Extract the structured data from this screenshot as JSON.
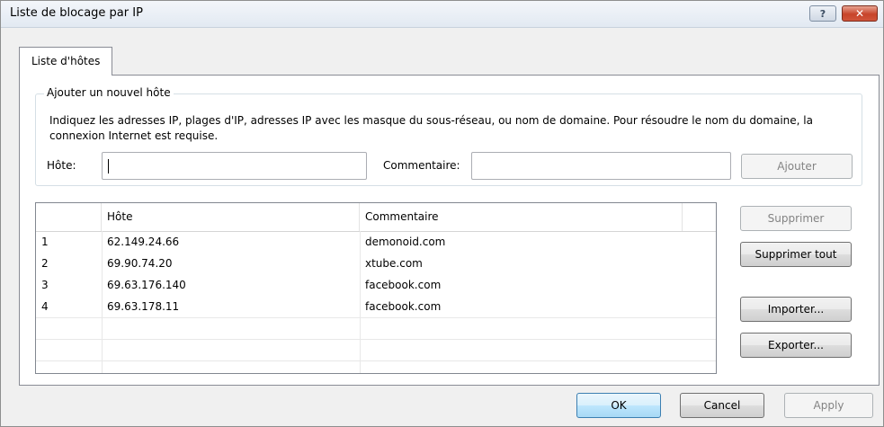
{
  "window": {
    "title": "Liste de blocage par IP",
    "help_glyph": "?",
    "close_glyph": "✕"
  },
  "tab": {
    "label": "Liste d'hôtes"
  },
  "add_group": {
    "label": "Ajouter un nouvel hôte",
    "description": "Indiquez les adresses IP, plages d'IP, adresses IP avec les masque du sous-réseau, ou nom de domaine. Pour résoudre le nom du domaine, la connexion Internet est requise.",
    "host_label": "Hôte:",
    "host_value": "",
    "comment_label": "Commentaire:",
    "comment_value": "",
    "add_button": "Ajouter"
  },
  "table": {
    "columns": [
      "",
      "Hôte",
      "Commentaire"
    ],
    "rows": [
      {
        "index": "1",
        "host": "62.149.24.66",
        "comment": "demonoid.com"
      },
      {
        "index": "2",
        "host": "69.90.74.20",
        "comment": "xtube.com"
      },
      {
        "index": "3",
        "host": "69.63.176.140",
        "comment": "facebook.com"
      },
      {
        "index": "4",
        "host": "69.63.178.11",
        "comment": "facebook.com"
      }
    ]
  },
  "side_buttons": {
    "delete": "Supprimer",
    "delete_all": "Supprimer tout",
    "import": "Importer...",
    "export": "Exporter..."
  },
  "footer": {
    "ok": "OK",
    "cancel": "Cancel",
    "apply": "Apply"
  }
}
